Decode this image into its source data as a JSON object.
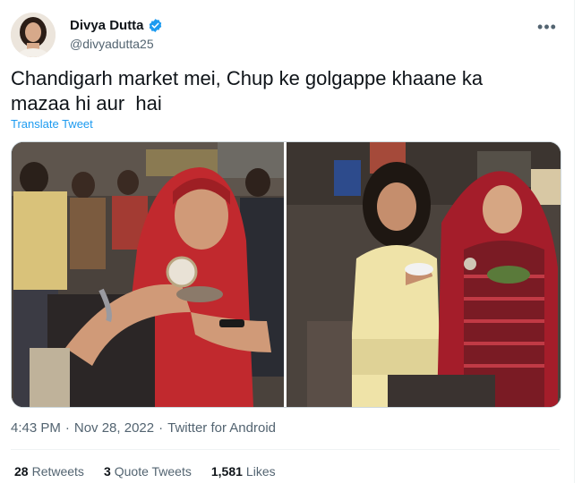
{
  "author": {
    "display_name": "Divya Dutta",
    "handle": "@divyadutta25",
    "verified": true
  },
  "more_menu_glyph": "•••",
  "tweet": {
    "text": "Chandigarh market mei, Chup ke golgappe khaane ka\nmazaa hi aur  hai",
    "translate_label": "Translate Tweet"
  },
  "meta": {
    "time": "4:43 PM",
    "separator": "·",
    "date": "Nov 28, 2022",
    "client": "Twitter for Android"
  },
  "stats": {
    "retweets_count": "28",
    "retweets_label": "Retweets",
    "quotes_count": "3",
    "quotes_label": "Quote Tweets",
    "likes_count": "1,581",
    "likes_label": "Likes"
  },
  "colors": {
    "accent": "#1d9bf0",
    "secondary_text": "#536471",
    "primary_text": "#0f1419"
  }
}
